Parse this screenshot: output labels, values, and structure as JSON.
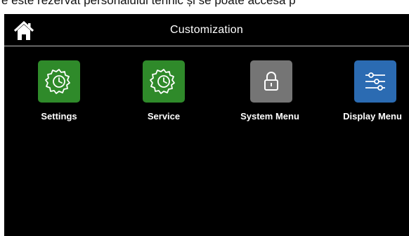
{
  "caption": "e este rezervat personalului tehnic și se poate accesa p",
  "header": {
    "title": "Customization",
    "home_icon": "home-icon"
  },
  "tiles": [
    {
      "label": "Settings",
      "icon": "gear-clock-icon",
      "color": "#2f8a2a"
    },
    {
      "label": "Service",
      "icon": "gear-clock-icon",
      "color": "#2f8a2a"
    },
    {
      "label": "System Menu",
      "icon": "padlock-icon",
      "color": "#757575"
    },
    {
      "label": "Display Menu",
      "icon": "sliders-icon",
      "color": "#2b6bb2"
    }
  ]
}
